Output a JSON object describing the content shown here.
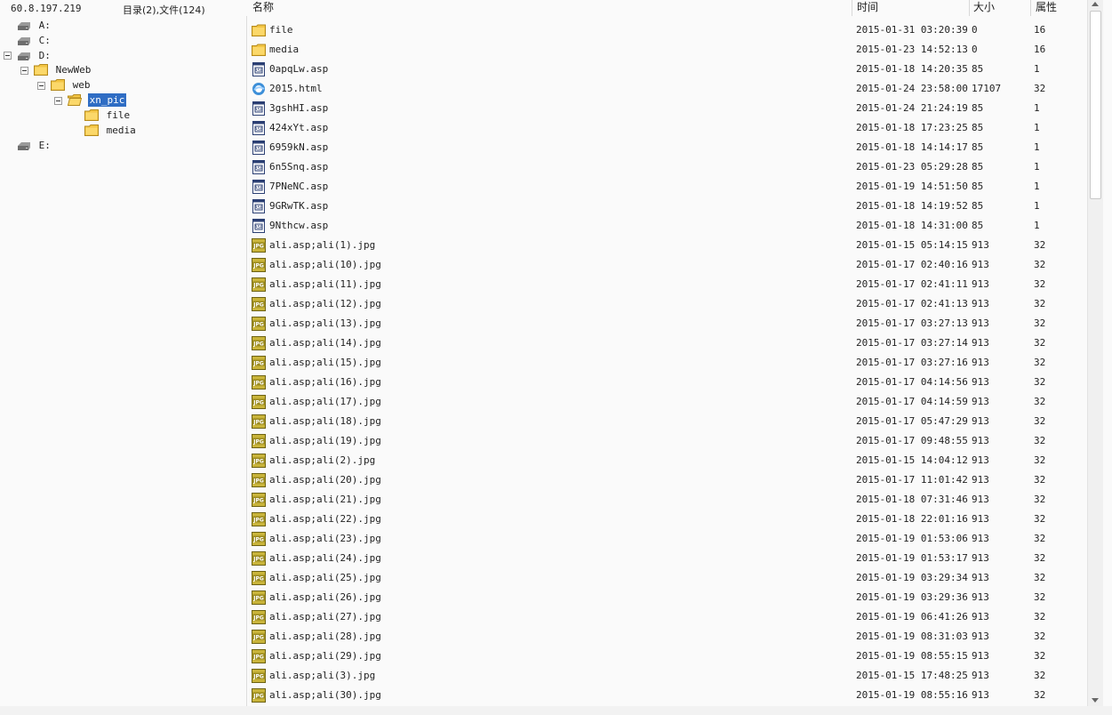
{
  "header": {
    "host": "60.8.197.219",
    "summary": "目录(2),文件(124)",
    "col_name": "名称",
    "col_time": "时间",
    "col_size": "大小",
    "col_attr": "属性"
  },
  "tree": {
    "drive_a": "A:",
    "drive_c": "C:",
    "drive_d": "D:",
    "folder_newweb": "NewWeb",
    "folder_web": "web",
    "folder_xn_pic": "xn_pic",
    "folder_file": "file",
    "folder_media": "media",
    "drive_e": "E:"
  },
  "files": [
    {
      "name": "file",
      "time": "2015-01-31 03:20:39",
      "size": "0",
      "attr": "16",
      "type": "folder"
    },
    {
      "name": "media",
      "time": "2015-01-23 14:52:13",
      "size": "0",
      "attr": "16",
      "type": "folder"
    },
    {
      "name": "0apqLw.asp",
      "time": "2015-01-18 14:20:35",
      "size": "85",
      "attr": "1",
      "type": "asp"
    },
    {
      "name": "2015.html",
      "time": "2015-01-24 23:58:00",
      "size": "17107",
      "attr": "32",
      "type": "html"
    },
    {
      "name": "3gshHI.asp",
      "time": "2015-01-24 21:24:19",
      "size": "85",
      "attr": "1",
      "type": "asp"
    },
    {
      "name": "424xYt.asp",
      "time": "2015-01-18 17:23:25",
      "size": "85",
      "attr": "1",
      "type": "asp"
    },
    {
      "name": "6959kN.asp",
      "time": "2015-01-18 14:14:17",
      "size": "85",
      "attr": "1",
      "type": "asp"
    },
    {
      "name": "6n5Snq.asp",
      "time": "2015-01-23 05:29:28",
      "size": "85",
      "attr": "1",
      "type": "asp"
    },
    {
      "name": "7PNeNC.asp",
      "time": "2015-01-19 14:51:50",
      "size": "85",
      "attr": "1",
      "type": "asp"
    },
    {
      "name": "9GRwTK.asp",
      "time": "2015-01-18 14:19:52",
      "size": "85",
      "attr": "1",
      "type": "asp"
    },
    {
      "name": "9Nthcw.asp",
      "time": "2015-01-18 14:31:00",
      "size": "85",
      "attr": "1",
      "type": "asp"
    },
    {
      "name": "ali.asp;ali(1).jpg",
      "time": "2015-01-15 05:14:15",
      "size": "913",
      "attr": "32",
      "type": "jpg"
    },
    {
      "name": "ali.asp;ali(10).jpg",
      "time": "2015-01-17 02:40:16",
      "size": "913",
      "attr": "32",
      "type": "jpg"
    },
    {
      "name": "ali.asp;ali(11).jpg",
      "time": "2015-01-17 02:41:11",
      "size": "913",
      "attr": "32",
      "type": "jpg"
    },
    {
      "name": "ali.asp;ali(12).jpg",
      "time": "2015-01-17 02:41:13",
      "size": "913",
      "attr": "32",
      "type": "jpg"
    },
    {
      "name": "ali.asp;ali(13).jpg",
      "time": "2015-01-17 03:27:13",
      "size": "913",
      "attr": "32",
      "type": "jpg"
    },
    {
      "name": "ali.asp;ali(14).jpg",
      "time": "2015-01-17 03:27:14",
      "size": "913",
      "attr": "32",
      "type": "jpg"
    },
    {
      "name": "ali.asp;ali(15).jpg",
      "time": "2015-01-17 03:27:16",
      "size": "913",
      "attr": "32",
      "type": "jpg"
    },
    {
      "name": "ali.asp;ali(16).jpg",
      "time": "2015-01-17 04:14:56",
      "size": "913",
      "attr": "32",
      "type": "jpg"
    },
    {
      "name": "ali.asp;ali(17).jpg",
      "time": "2015-01-17 04:14:59",
      "size": "913",
      "attr": "32",
      "type": "jpg"
    },
    {
      "name": "ali.asp;ali(18).jpg",
      "time": "2015-01-17 05:47:29",
      "size": "913",
      "attr": "32",
      "type": "jpg"
    },
    {
      "name": "ali.asp;ali(19).jpg",
      "time": "2015-01-17 09:48:55",
      "size": "913",
      "attr": "32",
      "type": "jpg"
    },
    {
      "name": "ali.asp;ali(2).jpg",
      "time": "2015-01-15 14:04:12",
      "size": "913",
      "attr": "32",
      "type": "jpg"
    },
    {
      "name": "ali.asp;ali(20).jpg",
      "time": "2015-01-17 11:01:42",
      "size": "913",
      "attr": "32",
      "type": "jpg"
    },
    {
      "name": "ali.asp;ali(21).jpg",
      "time": "2015-01-18 07:31:46",
      "size": "913",
      "attr": "32",
      "type": "jpg"
    },
    {
      "name": "ali.asp;ali(22).jpg",
      "time": "2015-01-18 22:01:16",
      "size": "913",
      "attr": "32",
      "type": "jpg"
    },
    {
      "name": "ali.asp;ali(23).jpg",
      "time": "2015-01-19 01:53:06",
      "size": "913",
      "attr": "32",
      "type": "jpg"
    },
    {
      "name": "ali.asp;ali(24).jpg",
      "time": "2015-01-19 01:53:17",
      "size": "913",
      "attr": "32",
      "type": "jpg"
    },
    {
      "name": "ali.asp;ali(25).jpg",
      "time": "2015-01-19 03:29:34",
      "size": "913",
      "attr": "32",
      "type": "jpg"
    },
    {
      "name": "ali.asp;ali(26).jpg",
      "time": "2015-01-19 03:29:36",
      "size": "913",
      "attr": "32",
      "type": "jpg"
    },
    {
      "name": "ali.asp;ali(27).jpg",
      "time": "2015-01-19 06:41:26",
      "size": "913",
      "attr": "32",
      "type": "jpg"
    },
    {
      "name": "ali.asp;ali(28).jpg",
      "time": "2015-01-19 08:31:03",
      "size": "913",
      "attr": "32",
      "type": "jpg"
    },
    {
      "name": "ali.asp;ali(29).jpg",
      "time": "2015-01-19 08:55:15",
      "size": "913",
      "attr": "32",
      "type": "jpg"
    },
    {
      "name": "ali.asp;ali(3).jpg",
      "time": "2015-01-15 17:48:25",
      "size": "913",
      "attr": "32",
      "type": "jpg"
    },
    {
      "name": "ali.asp;ali(30).jpg",
      "time": "2015-01-19 08:55:16",
      "size": "913",
      "attr": "32",
      "type": "jpg"
    }
  ],
  "icons": {
    "folder": "folder-icon",
    "asp": "asp-file-icon",
    "html": "html-file-icon",
    "jpg": "jpg-file-icon",
    "drive": "drive-icon"
  },
  "colors": {
    "selection": "#2f6dc4",
    "folder": "#f3c544",
    "jpg_icon": "#9a8a1e"
  }
}
